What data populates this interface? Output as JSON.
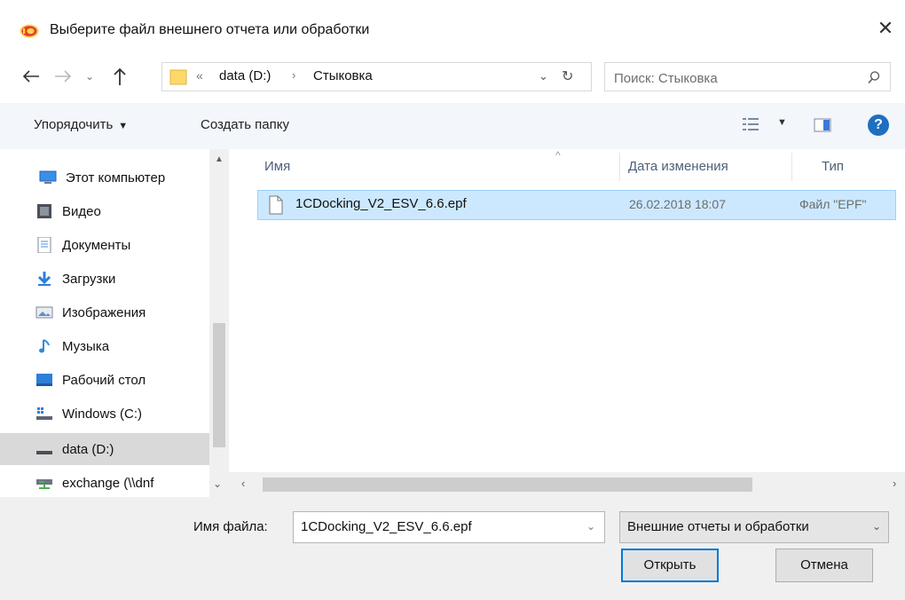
{
  "window": {
    "title": "Выберите файл внешнего отчета или обработки"
  },
  "address_bar": {
    "overflow": "«",
    "crumbs": [
      "data (D:)",
      "Стыковка"
    ]
  },
  "search": {
    "placeholder": "Поиск: Стыковка"
  },
  "toolbar": {
    "organize_label": "Упорядочить",
    "new_folder_label": "Создать папку"
  },
  "nav_pane": {
    "items": [
      {
        "label": "Этот компьютер",
        "icon": "computer-icon"
      },
      {
        "label": "Видео",
        "icon": "video-icon"
      },
      {
        "label": "Документы",
        "icon": "documents-icon"
      },
      {
        "label": "Загрузки",
        "icon": "downloads-icon"
      },
      {
        "label": "Изображения",
        "icon": "pictures-icon"
      },
      {
        "label": "Музыка",
        "icon": "music-icon"
      },
      {
        "label": "Рабочий стол",
        "icon": "desktop-icon"
      },
      {
        "label": "Windows (C:)",
        "icon": "windows-drive-icon"
      },
      {
        "label": "data (D:)",
        "icon": "drive-icon",
        "selected": true
      },
      {
        "label": "exchange (\\\\dnf",
        "icon": "network-drive-icon"
      }
    ]
  },
  "file_list": {
    "columns": [
      "Имя",
      "Дата изменения",
      "Тип"
    ],
    "rows": [
      {
        "name": "1CDocking_V2_ESV_6.6.epf",
        "date": "26.02.2018 18:07",
        "type": "Файл \"EPF\"",
        "selected": true
      }
    ]
  },
  "bottom": {
    "file_name_label": "Имя файла:",
    "file_name_value": "1CDocking_V2_ESV_6.6.epf",
    "filter_value": "Внешние отчеты и обработки",
    "open_label": "Открыть",
    "cancel_label": "Отмена"
  },
  "colors": {
    "selection_bg": "#cce8ff",
    "selection_border": "#99d1ff",
    "accent": "#0078d7",
    "toolbar_bg": "#f3f6fb"
  }
}
